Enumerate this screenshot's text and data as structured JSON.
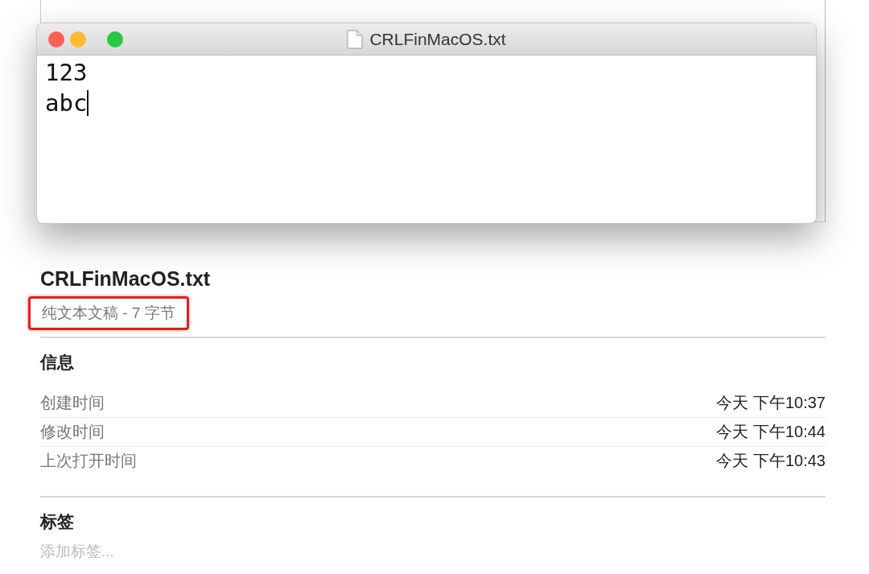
{
  "window": {
    "title": "CRLFinMacOS.txt",
    "lines": [
      "123",
      "abc"
    ]
  },
  "file": {
    "name": "CRLFinMacOS.txt",
    "subtitle": "纯文本文稿 - 7 字节",
    "highlighted": true
  },
  "info": {
    "heading": "信息",
    "rows": [
      {
        "label": "创建时间",
        "value": "今天 下午10:37"
      },
      {
        "label": "修改时间",
        "value": "今天 下午10:44"
      },
      {
        "label": "上次打开时间",
        "value": "今天 下午10:43"
      }
    ]
  },
  "tags": {
    "heading": "标签",
    "placeholder": "添加标签..."
  }
}
